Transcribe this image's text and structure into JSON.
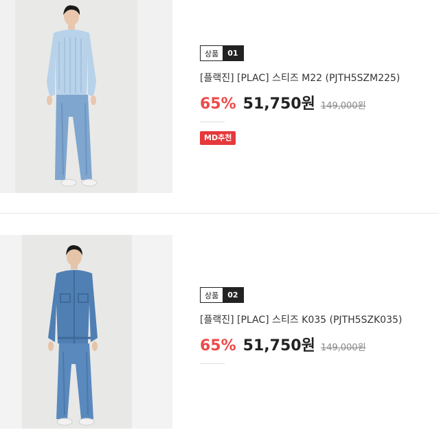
{
  "products": [
    {
      "rank_label": "상품",
      "rank_number": "01",
      "name": "[플랙진] [PLAC] 스티즈 M22 (PJTH5SZM225)",
      "discount": "65%",
      "sale_price": "51,750원",
      "original_price": "149,000원",
      "badge": "MD추천",
      "image_alt": "sweater-and-jeans-model"
    },
    {
      "rank_label": "상품",
      "rank_number": "02",
      "name": "[플랙진] [PLAC] 스티즈 K035 (PJTH5SZK035)",
      "discount": "65%",
      "sale_price": "51,750원",
      "original_price": "149,000원",
      "image_alt": "denim-jacket-and-jeans-model"
    }
  ],
  "colors": {
    "discount": "#ee4a4a",
    "badge_bg": "#e5393c",
    "rank_bg": "#222222"
  }
}
